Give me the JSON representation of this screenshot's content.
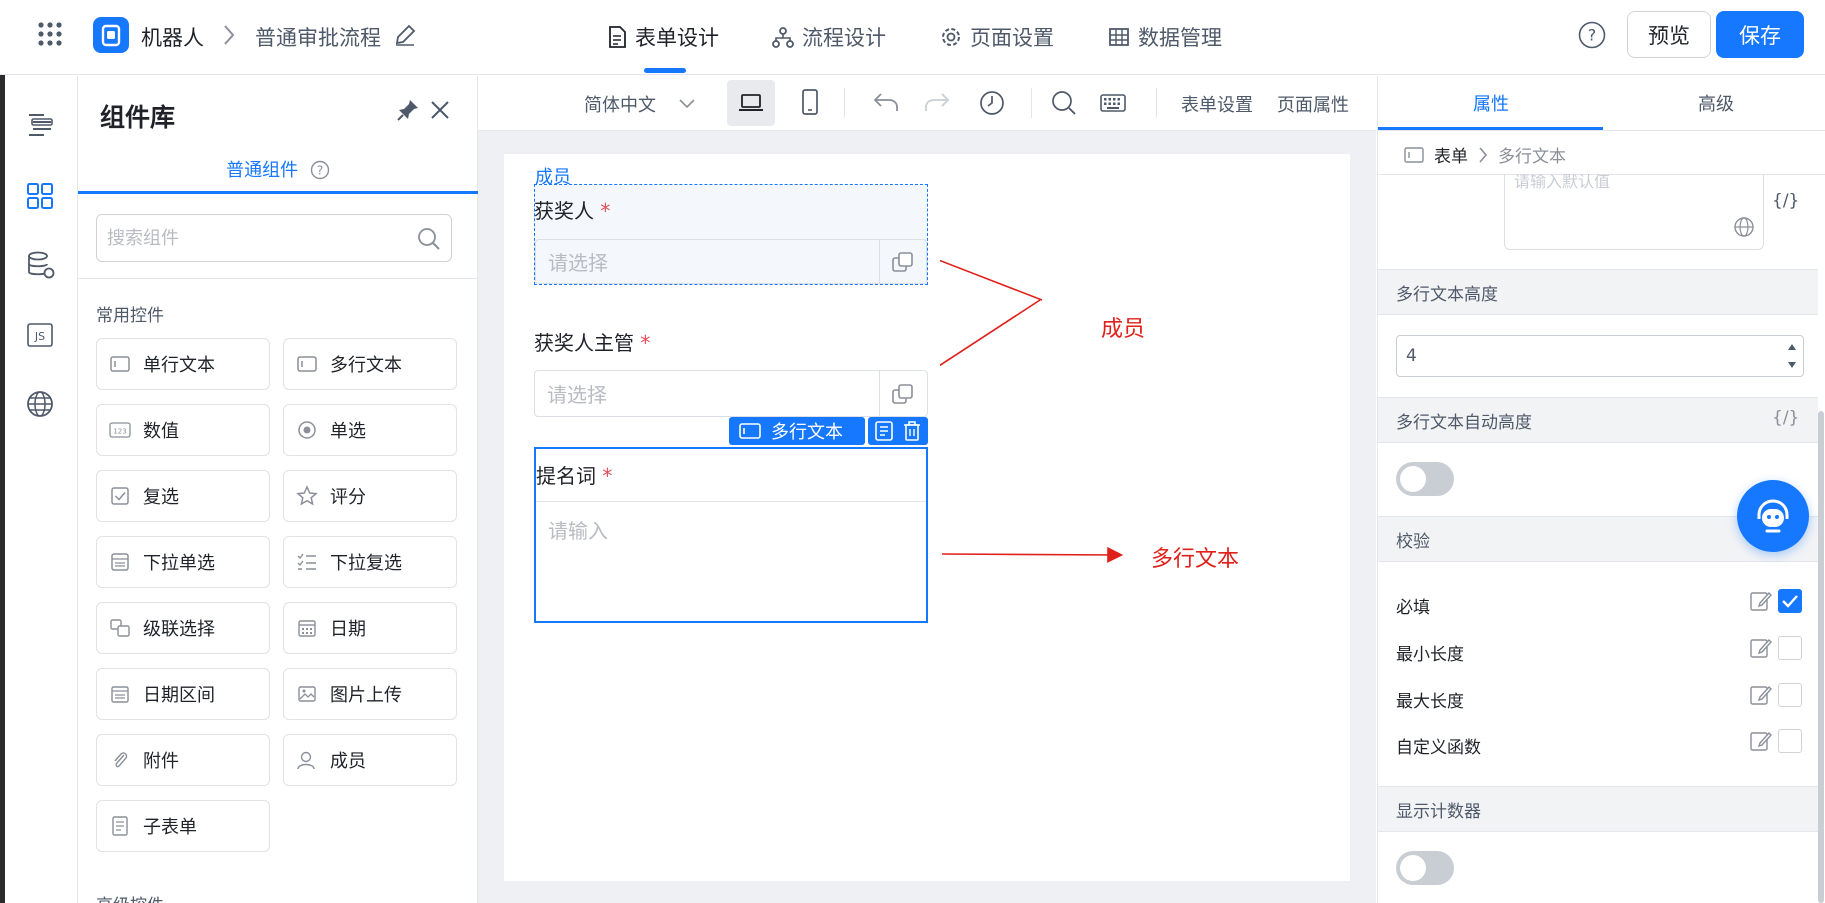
{
  "header": {
    "app_name": "机器人",
    "flow_name": "普通审批流程",
    "nav": [
      {
        "label": "表单设计",
        "active": true
      },
      {
        "label": "流程设计"
      },
      {
        "label": "页面设置"
      },
      {
        "label": "数据管理"
      }
    ],
    "help": "?",
    "preview_label": "预览",
    "save_label": "保存"
  },
  "panel": {
    "title": "组件库",
    "tab_label": "普通组件",
    "search_placeholder": "搜索组件",
    "section_common": "常用控件",
    "components": [
      {
        "label": "单行文本",
        "icon": "single-line-text-icon"
      },
      {
        "label": "多行文本",
        "icon": "multi-line-text-icon"
      },
      {
        "label": "数值",
        "icon": "number-icon"
      },
      {
        "label": "单选",
        "icon": "radio-icon"
      },
      {
        "label": "复选",
        "icon": "checkbox-icon"
      },
      {
        "label": "评分",
        "icon": "star-icon"
      },
      {
        "label": "下拉单选",
        "icon": "dropdown-icon"
      },
      {
        "label": "下拉复选",
        "icon": "dropdown-multi-icon"
      },
      {
        "label": "级联选择",
        "icon": "cascade-icon"
      },
      {
        "label": "日期",
        "icon": "calendar-icon"
      },
      {
        "label": "日期区间",
        "icon": "date-range-icon"
      },
      {
        "label": "图片上传",
        "icon": "image-icon"
      },
      {
        "label": "附件",
        "icon": "paperclip-icon"
      },
      {
        "label": "成员",
        "icon": "member-icon"
      },
      {
        "label": "子表单",
        "icon": "subform-icon"
      }
    ],
    "section_advanced": "高级控件"
  },
  "toolbar": {
    "language": "简体中文",
    "form_settings": "表单设置",
    "page_props": "页面属性"
  },
  "form": {
    "group_label": "成员",
    "field1": {
      "label": "获奖人",
      "required": "*",
      "placeholder": "请选择"
    },
    "field2": {
      "label": "获奖人主管",
      "required": "*",
      "placeholder": "请选择"
    },
    "selected_tag": "多行文本",
    "field3": {
      "label": "提名词",
      "required": "*",
      "placeholder": "请输入"
    }
  },
  "annotations": {
    "member": "成员",
    "multiline": "多行文本"
  },
  "right": {
    "tab_props": "属性",
    "tab_advanced": "高级",
    "breadcrumb_form": "表单",
    "breadcrumb_current": "多行文本",
    "default_placeholder": "请输入默认值",
    "expr": "{/}",
    "height_label": "多行文本高度",
    "height_value": "4",
    "auto_height_label": "多行文本自动高度",
    "auto_height_on": false,
    "validate_label": "校验",
    "validate_rules": [
      {
        "label": "必填",
        "checked": true
      },
      {
        "label": "最小长度",
        "checked": false
      },
      {
        "label": "最大长度",
        "checked": false
      },
      {
        "label": "自定义函数",
        "checked": false
      }
    ],
    "counter_label": "显示计数器",
    "counter_on": false
  }
}
